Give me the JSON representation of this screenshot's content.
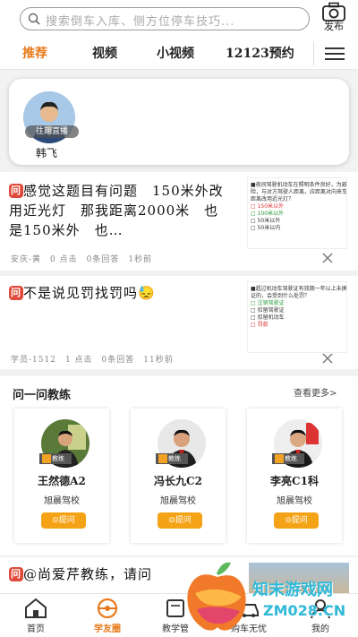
{
  "search": {
    "placeholder": "搜索倒车入库、侧方位停车技巧..."
  },
  "publish": {
    "label": "发布"
  },
  "tabs": [
    {
      "label": "推荐",
      "active": true
    },
    {
      "label": "视频"
    },
    {
      "label": "小视频"
    },
    {
      "label": "12123预约"
    }
  ],
  "live": {
    "badge": "往期直播",
    "name": "韩飞"
  },
  "posts": [
    {
      "badge": "问",
      "title": "感觉这题目有问题　150米外改用近光灯　那我距离2000米　也是150米外　也…",
      "meta": "安庆-黄　0 点击　0条回答　1秒前",
      "thumb_lines": [
        "■夜间驾驶机动车在照明条件良好，为避",
        "险，与对方驾驶人距离，应距离对向来车多远",
        "距离改用近光灯？",
        "□ 150米以外",
        "□ 100米以外",
        "□ 50米以外",
        "□ 50米以内"
      ]
    },
    {
      "badge": "问",
      "title": "不是说见罚找罚吗😓",
      "meta": "学员-1512　1 点击　0条回答　11秒前",
      "thumb_lines": [
        "■超过机动车驾驶证有效期一年以上未换",
        "证的，会受到什么处罚？",
        "□ 注销驾驶证",
        "□ 扣留驾驶证",
        "□ 扣留机动车",
        "□ 罚款"
      ]
    }
  ],
  "coach_section": {
    "title": "问一问教练",
    "more": "查看更多>",
    "coaches": [
      {
        "name": "王然德A2",
        "school": "旭晨驾校",
        "tag": "教练",
        "button": "⊙提问"
      },
      {
        "name": "冯长九C2",
        "school": "旭晨驾校",
        "tag": "教练",
        "button": "⊙提问"
      },
      {
        "name": "李亮C1科",
        "school": "旭晨驾校",
        "tag": "教练",
        "button": "⊙提问"
      }
    ]
  },
  "partial_post": {
    "badge": "问",
    "title": "@尚爱芹教练，请问"
  },
  "bottom_nav": [
    {
      "label": "首页"
    },
    {
      "label": "学友圈",
      "active": true
    },
    {
      "label": "教学管"
    },
    {
      "label": "购车无忧"
    },
    {
      "label": "我的"
    }
  ],
  "watermark": {
    "text": "知末游戏网",
    "url": "ZM028.CN"
  },
  "colors": {
    "accent": "#e8791a",
    "question_badge": "#e04a3a",
    "ask_button": "#f5a316"
  }
}
